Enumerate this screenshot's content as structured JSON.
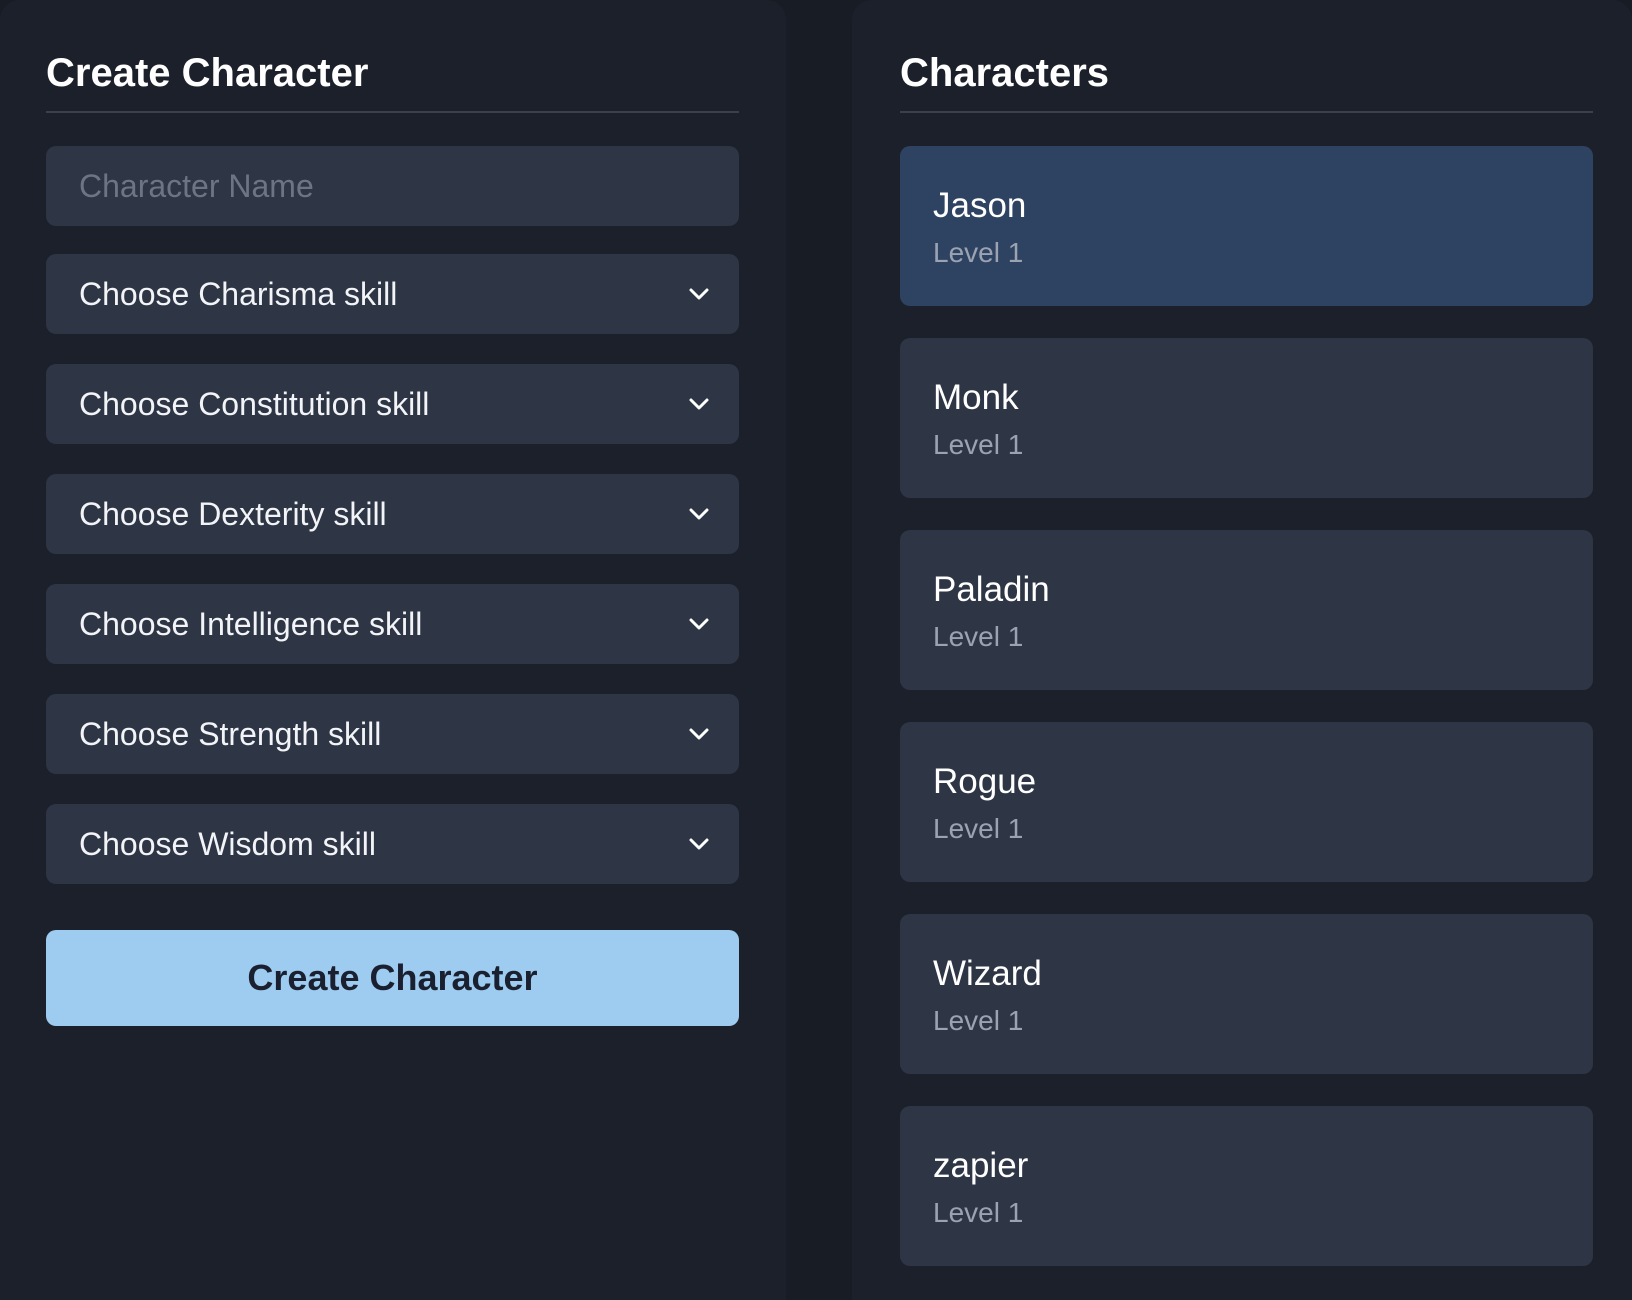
{
  "create_panel": {
    "title": "Create Character",
    "name_placeholder": "Character Name",
    "selects": [
      {
        "label": "Choose Charisma skill"
      },
      {
        "label": "Choose Constitution skill"
      },
      {
        "label": "Choose Dexterity skill"
      },
      {
        "label": "Choose Intelligence skill"
      },
      {
        "label": "Choose Strength skill"
      },
      {
        "label": "Choose Wisdom skill"
      }
    ],
    "submit_label": "Create Character",
    "colors": {
      "button_bg": "#9ecbf0",
      "field_bg": "#2e3545"
    }
  },
  "characters_panel": {
    "title": "Characters",
    "selected_index": 0,
    "items": [
      {
        "name": "Jason",
        "level": "Level 1"
      },
      {
        "name": "Monk",
        "level": "Level 1"
      },
      {
        "name": "Paladin",
        "level": "Level 1"
      },
      {
        "name": "Rogue",
        "level": "Level 1"
      },
      {
        "name": "Wizard",
        "level": "Level 1"
      },
      {
        "name": "zapier",
        "level": "Level 1"
      }
    ],
    "colors": {
      "selected_bg": "#2e4262",
      "card_bg": "#2e3545"
    }
  },
  "icons": {
    "select_arrow": "chevron-down-icon"
  }
}
